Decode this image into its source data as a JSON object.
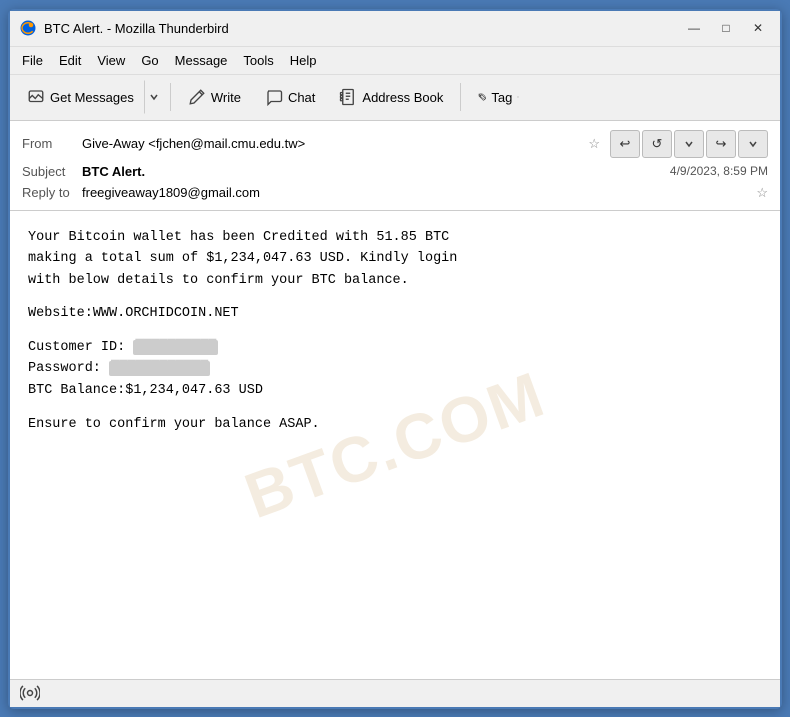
{
  "window": {
    "title": "BTC Alert. - Mozilla Thunderbird",
    "icon": "thunderbird-icon"
  },
  "window_controls": {
    "minimize": "—",
    "maximize": "□",
    "close": "✕"
  },
  "menu": {
    "items": [
      "File",
      "Edit",
      "View",
      "Go",
      "Message",
      "Tools",
      "Help"
    ]
  },
  "toolbar": {
    "get_messages_label": "Get Messages",
    "write_label": "Write",
    "chat_label": "Chat",
    "address_book_label": "Address Book",
    "tag_label": "Tag"
  },
  "email": {
    "from_label": "From",
    "from_value": "Give-Away <fjchen@mail.cmu.edu.tw>",
    "subject_label": "Subject",
    "subject_value": "BTC Alert.",
    "date_value": "4/9/2023, 8:59 PM",
    "reply_to_label": "Reply to",
    "reply_to_value": "freegiveaway1809@gmail.com"
  },
  "body": {
    "paragraph1": "Your Bitcoin wallet has been Credited with 51.85 BTC\nmaking a total sum of $1,234,047.63 USD. Kindly login\nwith below details to confirm your BTC balance.",
    "website_label": "Website:",
    "website_value": "WWW.ORCHIDCOIN.NET",
    "customer_id_label": "Customer ID:",
    "customer_id_redacted": "██████████",
    "password_label": "Password:",
    "password_redacted": "████████████",
    "btc_balance_label": "BTC Balance:",
    "btc_balance_value": "$1,234,047.63 USD",
    "closing": "Ensure to confirm your balance ASAP."
  },
  "watermark": {
    "text": "BTC.COM"
  },
  "status_bar": {
    "icon": "radio-tower-icon"
  }
}
